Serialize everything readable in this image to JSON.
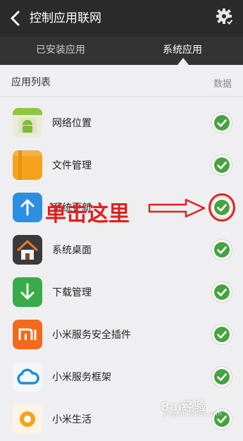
{
  "header": {
    "title": "控制应用联网",
    "back_icon": "chevron-left-icon",
    "settings_icon": "gear-check-icon"
  },
  "tabs": [
    {
      "label": "已安装应用"
    },
    {
      "label": "系统应用"
    }
  ],
  "section": {
    "title": "应用列表",
    "right_label": "数据"
  },
  "apps": [
    {
      "label": "网络位置",
      "icon": "android-location-icon",
      "checked": true
    },
    {
      "label": "文件管理",
      "icon": "folder-icon",
      "checked": true
    },
    {
      "label": "系统更新",
      "icon": "upload-arrow-icon",
      "checked": true
    },
    {
      "label": "系统桌面",
      "icon": "house-icon",
      "checked": true
    },
    {
      "label": "下载管理",
      "icon": "download-arrow-icon",
      "checked": true
    },
    {
      "label": "小米服务安全插件",
      "icon": "mi-logo-icon",
      "checked": true
    },
    {
      "label": "小米服务框架",
      "icon": "cloud-icon",
      "checked": true
    },
    {
      "label": "小米生活",
      "icon": "mi-life-icon",
      "checked": true
    }
  ],
  "annotation": {
    "text": "单击这里"
  },
  "watermark": {
    "text": "Bai经验",
    "subtext": "jingyan.baidu.com"
  },
  "colors": {
    "header": "#2b2b2b",
    "tabs": "#333333",
    "check_green": "#46a33f",
    "annotation_red": "#e0201e",
    "background": "#efeff1"
  }
}
